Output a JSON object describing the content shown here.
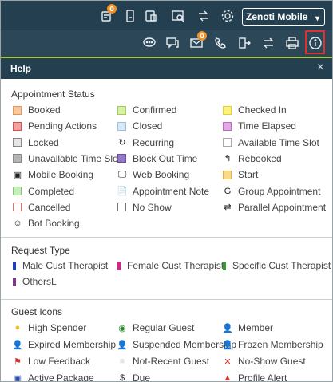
{
  "header": {
    "location_select": "Zenoti Mobile",
    "top_icons": [
      {
        "name": "appointments-icon",
        "badge": "0"
      },
      {
        "name": "device-icon"
      },
      {
        "name": "image-search-icon"
      },
      {
        "name": "swap-user-icon"
      },
      {
        "name": "gear-icon"
      }
    ],
    "second_icons": [
      {
        "name": "chat-icon"
      },
      {
        "name": "messages-icon"
      },
      {
        "name": "mail-icon",
        "badge": "0"
      },
      {
        "name": "phone-icon"
      },
      {
        "name": "logout-icon"
      },
      {
        "name": "transfer-icon"
      },
      {
        "name": "print-icon"
      },
      {
        "name": "info-icon"
      }
    ]
  },
  "help": {
    "title": "Help",
    "close": "×",
    "appointment_status": {
      "title": "Appointment Status",
      "items": [
        {
          "label": "Booked",
          "kind": "swatch",
          "fill": "#f9c89b",
          "border": "#e7925b"
        },
        {
          "label": "Confirmed",
          "kind": "swatch",
          "fill": "#d8f0a6",
          "border": "#9fcf55"
        },
        {
          "label": "Checked In",
          "kind": "swatch",
          "fill": "#fbf27b",
          "border": "#e2cf39"
        },
        {
          "label": "Pending Actions",
          "kind": "swatch",
          "fill": "#f4a0a0",
          "border": "#d65050"
        },
        {
          "label": "Closed",
          "kind": "swatch",
          "fill": "#d7e9f8",
          "border": "#9cc0e0"
        },
        {
          "label": "Time Elapsed",
          "kind": "swatch",
          "fill": "#e4a7e8",
          "border": "#b96cbf"
        },
        {
          "label": "Locked",
          "kind": "swatch",
          "fill": "#e6e6e6",
          "border": "#888888"
        },
        {
          "label": "Recurring",
          "kind": "glyph",
          "glyph": "↻"
        },
        {
          "label": "Available Time Slot",
          "kind": "swatch",
          "fill": "#ffffff",
          "border": "#aaaaaa"
        },
        {
          "label": "Unavailable Time Slot",
          "kind": "swatch",
          "fill": "#b5b5b5",
          "border": "#888888"
        },
        {
          "label": "Block Out Time",
          "kind": "swatch",
          "fill": "#9577c7",
          "border": "#6b4f9e"
        },
        {
          "label": "Rebooked",
          "kind": "glyph",
          "glyph": "↰"
        },
        {
          "label": "Mobile Booking",
          "kind": "glyph",
          "glyph": "▣"
        },
        {
          "label": "Web Booking",
          "kind": "glyph",
          "glyph": "🖵"
        },
        {
          "label": "Start",
          "kind": "swatch",
          "fill": "#fbd98a",
          "border": "#e3b14a"
        },
        {
          "label": "Completed",
          "kind": "swatch",
          "fill": "#c6ecc0",
          "border": "#7fc46f"
        },
        {
          "label": "Appointment Note",
          "kind": "glyph",
          "glyph": "📄"
        },
        {
          "label": "Group Appointment",
          "kind": "glyph",
          "glyph": "G"
        },
        {
          "label": "Cancelled",
          "kind": "swatch",
          "fill": "#ffffff",
          "border": "#e27070"
        },
        {
          "label": "No Show",
          "kind": "swatch",
          "fill": "#ffffff",
          "border": "#777777"
        },
        {
          "label": "Parallel Appointment",
          "kind": "glyph",
          "glyph": "⇄"
        },
        {
          "label": "Bot Booking",
          "kind": "glyph",
          "glyph": "☺"
        }
      ]
    },
    "request_type": {
      "title": "Request Type",
      "items": [
        {
          "label": "Male Cust Therapist",
          "color": "#1f3fbf"
        },
        {
          "label": "Female Cust Therapist",
          "color": "#e0208a"
        },
        {
          "label": "Specific Cust Therapist",
          "color": "#3a9a3a"
        },
        {
          "label": "OthersL",
          "color": "#7a3a8a"
        }
      ]
    },
    "guest_icons": {
      "title": "Guest Icons",
      "items": [
        {
          "label": "High Spender",
          "glyph": "●",
          "color": "#f2c21b"
        },
        {
          "label": "Regular Guest",
          "glyph": "◉",
          "color": "#2f8a2f"
        },
        {
          "label": "Member",
          "glyph": "👤",
          "color": "#d9574a"
        },
        {
          "label": "Expired Membership",
          "glyph": "👤",
          "color": "#c96a50"
        },
        {
          "label": "Suspended Membership",
          "glyph": "👤",
          "color": "#333333"
        },
        {
          "label": "Frozen Membership",
          "glyph": "👤",
          "color": "#3b7dc4"
        },
        {
          "label": "Low Feedback",
          "glyph": "⚑",
          "color": "#d32f2f"
        },
        {
          "label": "Not-Recent Guest",
          "glyph": "■",
          "color": "#e6e6e6"
        },
        {
          "label": "No-Show Guest",
          "glyph": "✕",
          "color": "#d32f2f"
        },
        {
          "label": "Active Package",
          "glyph": "▣",
          "color": "#2f4fa8"
        },
        {
          "label": "Due",
          "glyph": "$",
          "color": "#333333"
        },
        {
          "label": "Profile Alert",
          "glyph": "▲",
          "color": "#d32f2f"
        }
      ]
    }
  }
}
